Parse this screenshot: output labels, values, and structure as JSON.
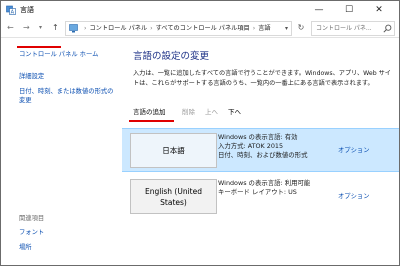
{
  "window": {
    "title": "言語",
    "controls": {
      "minimize": "—",
      "maximize": "☐",
      "close": "✕"
    }
  },
  "address": {
    "nav": {
      "back": "←",
      "forward": "→",
      "recent": "▾",
      "up": "↑"
    },
    "crumbs": [
      "コントロール パネル",
      "すべてのコントロール パネル項目",
      "言語"
    ],
    "separator": "›",
    "dropdown": "▾",
    "refresh": "↻",
    "search_placeholder": "コントロール パネ..."
  },
  "sidebar": {
    "home": "コントロール パネル ホーム",
    "advanced": "詳細設定",
    "datetime": "日付、時刻、または数値の形式の変更",
    "related_heading": "関連項目",
    "font": "フォント",
    "location": "場所"
  },
  "main": {
    "title": "言語の設定の変更",
    "description": "入力は、一覧に追加したすべての言語で行うことができます。Windows、アプリ、Web サイトは、これらがサポートする言語のうち、一覧内の一番上にある言語で表示されます。",
    "toolbar": {
      "add": "言語の追加",
      "remove": "削除",
      "up": "上へ",
      "down": "下へ"
    },
    "languages": [
      {
        "name": "日本語",
        "details": [
          "Windows の表示言語: 有効",
          "入力方式: ATOK 2015",
          "日付、時刻、および数値の形式"
        ],
        "options": "オプション"
      },
      {
        "name": "English (United States)",
        "details": [
          "Windows の表示言語: 利用可能",
          "キーボード レイアウト: US"
        ],
        "options": "オプション"
      }
    ]
  },
  "colors": {
    "link": "#0a4eb1",
    "title_blue": "#1e3287",
    "selection": "#cce8ff",
    "annotation_red": "#e00000"
  },
  "icons": [
    "language-icon",
    "control-panel-icon",
    "search-icon",
    "refresh-icon"
  ]
}
